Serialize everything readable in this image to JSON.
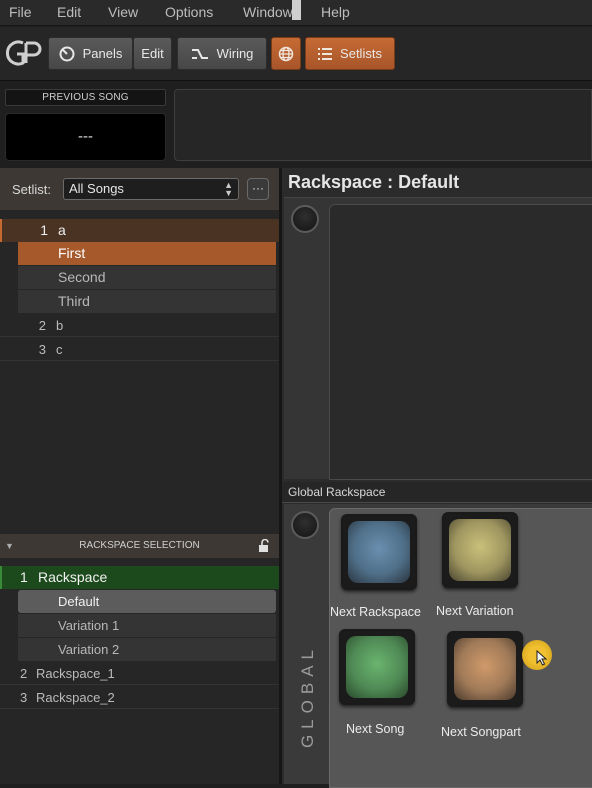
{
  "menu": [
    "File",
    "Edit",
    "View",
    "Options",
    "Window",
    "Help"
  ],
  "toolbar": {
    "panels": "Panels",
    "edit": "Edit",
    "wiring": "Wiring",
    "setlists": "Setlists"
  },
  "previous_song": {
    "label": "PREVIOUS SONG",
    "value": "---"
  },
  "setlist": {
    "label": "Setlist:",
    "selected": "All Songs",
    "more": "···"
  },
  "songs": [
    {
      "num": "1",
      "name": "a",
      "parts": [
        "First",
        "Second",
        "Third"
      ]
    },
    {
      "num": "2",
      "name": "b"
    },
    {
      "num": "3",
      "name": "c"
    }
  ],
  "rackspace_selection": {
    "header": "RACKSPACE SELECTION",
    "items": [
      {
        "num": "1",
        "name": "Rackspace",
        "variations": [
          "Default",
          "Variation 1",
          "Variation 2"
        ]
      },
      {
        "num": "2",
        "name": "Rackspace_1"
      },
      {
        "num": "3",
        "name": "Rackspace_2"
      }
    ]
  },
  "rackspace": {
    "title": "Rackspace : Default"
  },
  "global": {
    "label": "Global Rackspace",
    "vertical": "GLOBAL",
    "pads": [
      {
        "label": "Next Rackspace",
        "color": "#6a8fb0"
      },
      {
        "label": "Next Variation",
        "color": "#c9c07a"
      },
      {
        "label": "Next Song",
        "color": "#6ab46e"
      },
      {
        "label": "Next Songpart",
        "color": "#d09a6a"
      }
    ]
  },
  "colors": {
    "accent_orange": "#b15e2e",
    "rackspace_active_green": "#1e5e1e"
  }
}
